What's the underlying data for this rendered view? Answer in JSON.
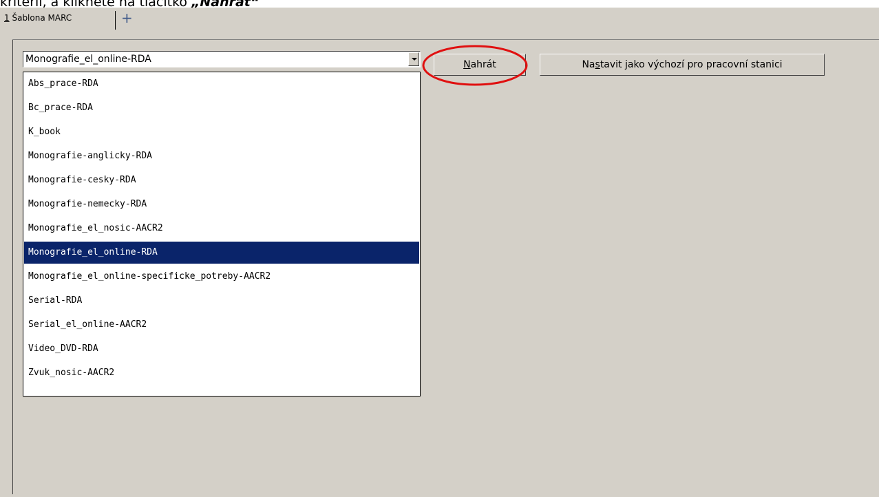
{
  "caption": {
    "text": "kritérii, a klikněte na tlačítko",
    "emphasis": "„Nahrát“"
  },
  "tabs": [
    {
      "number": "1",
      "label": "Šablona MARC"
    }
  ],
  "add_tab_label": "+",
  "combo": {
    "selected_value": "Monografie_el_online-RDA"
  },
  "list": {
    "items": [
      "Abs_prace-RDA",
      "Bc_prace-RDA",
      "K_book",
      "Monografie-anglicky-RDA",
      "Monografie-cesky-RDA",
      "Monografie-nemecky-RDA",
      "Monografie_el_nosic-AACR2",
      "Monografie_el_online-RDA",
      "Monografie_el_online-specificke_potreby-AACR2",
      "Serial-RDA",
      "Serial_el_online-AACR2",
      "Video_DVD-RDA",
      "Zvuk_nosic-AACR2"
    ],
    "selected_index": 7
  },
  "buttons": {
    "load": {
      "accel": "N",
      "rest": "ahrát"
    },
    "default": {
      "pre": "Na",
      "accel": "s",
      "rest": "tavit jako výchozí pro pracovní stanici"
    }
  },
  "colors": {
    "window_bg": "#d4d0c8",
    "selection": "#0a246a",
    "annotation": "#e01010"
  }
}
